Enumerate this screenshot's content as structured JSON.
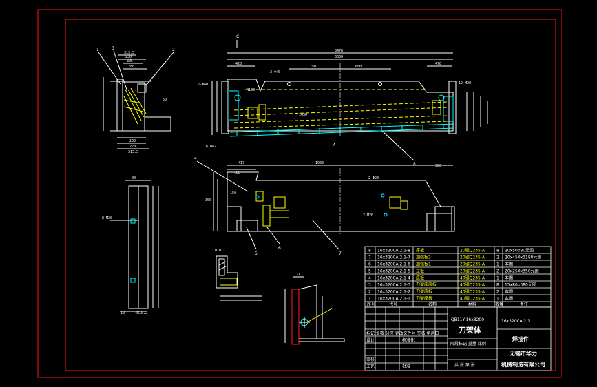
{
  "drawing": {
    "overall_dims": {
      "total_width": "3478",
      "inner_width": "3330",
      "bottom_width": "1900",
      "d_420": "420",
      "d_2_40": "2-Φ40",
      "d_750": "750",
      "d_680": "680",
      "d_60": "60",
      "d_470": "470",
      "d_12_m20": "12-M20",
      "d_r100": "R100",
      "d_1630": "1630",
      "d_8_40": "2-Φ40",
      "d_16_42": "16-Φ42",
      "d_417": "417",
      "d_180": "180",
      "d_2_20": "2-Φ20",
      "d_380": "380",
      "d_2_m20": "2-M20",
      "d_150": "150",
      "d_300": "300",
      "d_313_5": "313.5",
      "d_230": "230",
      "d_305": "305",
      "d_280": "280",
      "d_220": "220",
      "d_60b": "60",
      "d_200": "200",
      "d_313": "313.5",
      "d_48": "48±0.2",
      "d_10": "10",
      "d_8_m20": "8-M20"
    },
    "section_labels": {
      "c_marker": "C",
      "a_a": "A-A",
      "c_c": "C-C",
      "a_small": "A"
    },
    "callouts": [
      "1",
      "2",
      "3",
      "4",
      "5",
      "6",
      "7",
      "8"
    ]
  },
  "parts_list": {
    "rows": [
      {
        "no": "8",
        "code": "16x3200A.2.1-8",
        "name": "撑板",
        "material": "20钢Q235-A",
        "qty": "8",
        "note": "20x50x80元图"
      },
      {
        "no": "7",
        "code": "16x3200A.2.1-7",
        "name": "加强板2",
        "material": "20钢Q235-A",
        "qty": "2",
        "note": "20x450x3180元图"
      },
      {
        "no": "6",
        "code": "16x3200A.2.1-6",
        "name": "加强板1",
        "material": "20钢Q235-A",
        "qty": "1",
        "note": "本图"
      },
      {
        "no": "5",
        "code": "16x3200A.2.1-5",
        "name": "立板",
        "material": "20钢Q235-A",
        "qty": "2",
        "note": "20x250x350元图"
      },
      {
        "no": "4",
        "code": "16x3200A.2.1-4",
        "name": "底板",
        "material": "40钢Q235-A",
        "qty": "1",
        "note": "本图"
      },
      {
        "no": "3",
        "code": "16x3200A.2.1-3",
        "name": "刀架座底板",
        "material": "40钢Q235-A",
        "qty": "8",
        "note": "15x80x380元图"
      },
      {
        "no": "2",
        "code": "16x3200A.2.1-2",
        "name": "刀架底板",
        "material": "40钢Q235-A",
        "qty": "2",
        "note": "本图"
      },
      {
        "no": "1",
        "code": "16x3200A.2.1-1",
        "name": "刀架座板",
        "material": "40钢Q235-A",
        "qty": "1",
        "note": "本图"
      }
    ],
    "header": {
      "no": "序号",
      "code": "代号",
      "name": "名称",
      "qty": "数量",
      "material": "材料",
      "note": "备注"
    }
  },
  "title_block": {
    "standard": "QB11Y-16x3200",
    "drawing_no": "16x3200A.2.1",
    "part_name": "刀架体",
    "category": "焊接件",
    "company_line1": "无锡市华力",
    "company_line2": "机械制造有限公司",
    "labels": {
      "revision": "标记 处数 分区 更改文件号 签名 年月日",
      "design": "设计",
      "standardization": "标准化",
      "stage": "阶段标记 重量 比例",
      "check": "审核",
      "process": "工艺",
      "approve": "批准",
      "sheets": "共 张 第 张"
    }
  },
  "colors": {
    "frame": "#ff1a1a",
    "geometry": "#ffffff",
    "hidden": "#ffff00",
    "bolts": "#00ffff",
    "background": "#000000"
  }
}
